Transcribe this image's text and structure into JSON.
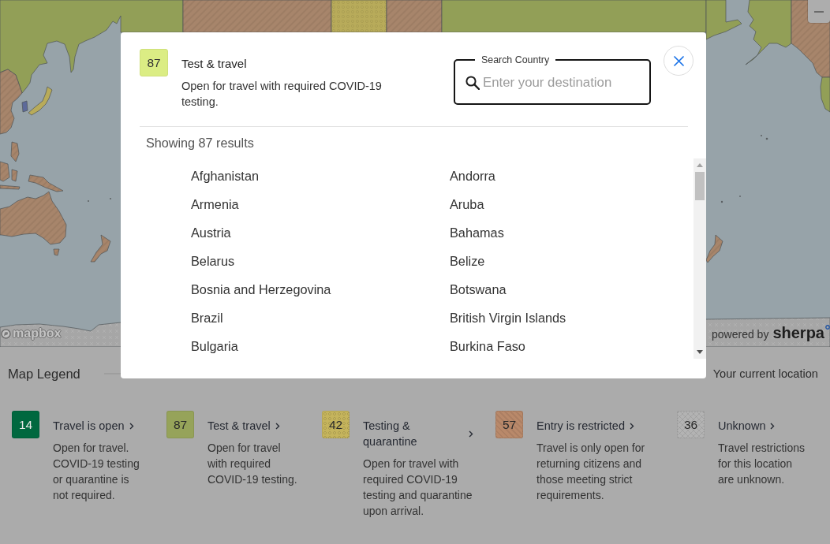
{
  "map": {
    "attribution": "mapbox",
    "powered_by": "powered by",
    "brand": "sherpa"
  },
  "modal": {
    "category": {
      "count": "87",
      "title": "Test & travel",
      "description": "Open for travel with required COVID-19 testing."
    },
    "search": {
      "label": "Search Country",
      "placeholder": "Enter your destination"
    },
    "results_count": "Showing 87 results",
    "results": [
      "Afghanistan",
      "Andorra",
      "Armenia",
      "Aruba",
      "Austria",
      "Bahamas",
      "Belarus",
      "Belize",
      "Bosnia and Herzegovina",
      "Botswana",
      "Brazil",
      "British Virgin Islands",
      "Bulgaria",
      "Burkina Faso"
    ]
  },
  "legend": {
    "title": "Map Legend",
    "current_location": "Your current location",
    "items": [
      {
        "count": "14",
        "title": "Travel is open",
        "description": "Open for travel. COVID-19 testing or quarantine is not required.",
        "color": "#00683f",
        "kind": "solid"
      },
      {
        "count": "87",
        "title": "Test & travel",
        "description": "Open for travel with required COVID-19 testing.",
        "color": "#96a35a",
        "kind": "solid"
      },
      {
        "count": "42",
        "title": "Testing & quarantine",
        "description": "Open for travel with required COVID-19 testing and quarantine upon arrival.",
        "color": "#c5b45c",
        "kind": "dots"
      },
      {
        "count": "57",
        "title": "Entry is restricted",
        "description": "Travel is only open for returning citizens and those meeting strict requirements.",
        "color": "#b9896a",
        "kind": "stripes"
      },
      {
        "count": "36",
        "title": "Unknown",
        "description": "Travel restrictions for this location are unknown.",
        "color": "#b3b3b3",
        "kind": "crosses"
      }
    ]
  }
}
